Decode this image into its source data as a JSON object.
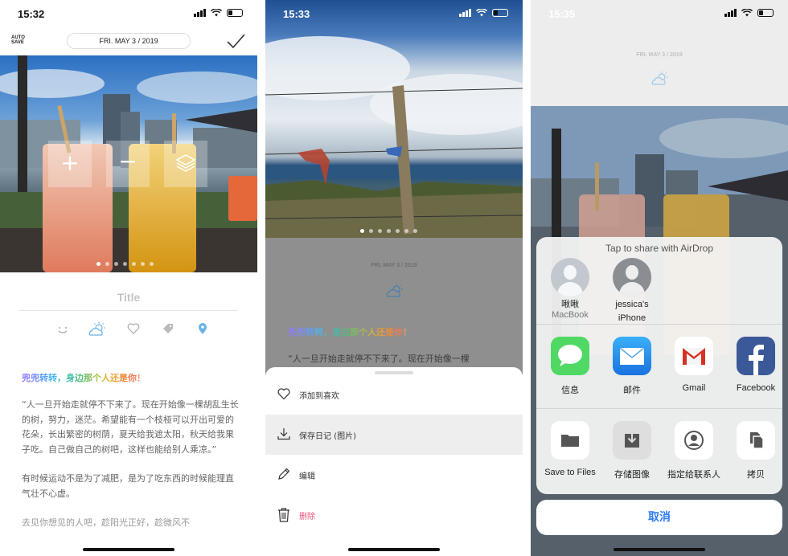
{
  "phone1": {
    "status_time": "15:32",
    "autosave": [
      "AUTO",
      "SAVE"
    ],
    "date_label": "FRI. MAY 3 / 2019",
    "title_placeholder": "Title",
    "colored_text": [
      {
        "text": "兜",
        "color": "#8e7cff"
      },
      {
        "text": "兜",
        "color": "#7a8cff"
      },
      {
        "text": "转",
        "color": "#5aa0ff"
      },
      {
        "text": "转",
        "color": "#4bb7f0"
      },
      {
        "text": "，",
        "color": "#48c0c8"
      },
      {
        "text": "身",
        "color": "#3fbfa8"
      },
      {
        "text": "边",
        "color": "#4fbf80"
      },
      {
        "text": "那",
        "color": "#7ac060"
      },
      {
        "text": "个",
        "color": "#a9c040"
      },
      {
        "text": "人",
        "color": "#d8b830"
      },
      {
        "text": "还",
        "color": "#f0a030"
      },
      {
        "text": "是",
        "color": "#f28a3a"
      },
      {
        "text": "你",
        "color": "#f47a50"
      },
      {
        "text": "！",
        "color": "#f0a070"
      }
    ],
    "paragraphs": [
      "“人一旦开始走就停不下来了。现在开始像一棵胡乱生长的树，努力，迷茫。希望能有一个枝桠可以开出可爱的花朵，长出繁密的树荫，夏天给我遮太阳，秋天给我果子吃。自己做自己的树吧，这样也能给别人乘凉。”",
      "有时候运动不是为了减肥，是为了吃东西的时候能理直气壮不心虚。",
      "去见你想见的人吧，趁阳光正好，趁微风不"
    ]
  },
  "phone2": {
    "status_time": "15:33",
    "date_label": "FRI. MAY 3 / 2019",
    "body_preview": "“人一旦开始走就停不下来了。现在开始像一棵",
    "menu": [
      {
        "label": "添加到喜欢",
        "icon": "heart-icon"
      },
      {
        "label": "保存日记 (图片)",
        "icon": "download-icon"
      },
      {
        "label": "编辑",
        "icon": "pencil-icon"
      },
      {
        "label": "删除",
        "icon": "trash-icon"
      }
    ]
  },
  "phone3": {
    "status_time": "15:35",
    "date_label": "FRI. MAY 3 / 2019",
    "airdrop_title": "Tap to share with AirDrop",
    "contacts": [
      {
        "name": "啾啾",
        "device": "MacBook"
      },
      {
        "name": "jessica's",
        "device": "iPhone"
      }
    ],
    "apps": [
      "信息",
      "邮件",
      "Gmail",
      "Facebook"
    ],
    "actions": [
      "Save to Files",
      "存储图像",
      "指定给联系人",
      "拷贝"
    ],
    "cancel": "取消"
  }
}
